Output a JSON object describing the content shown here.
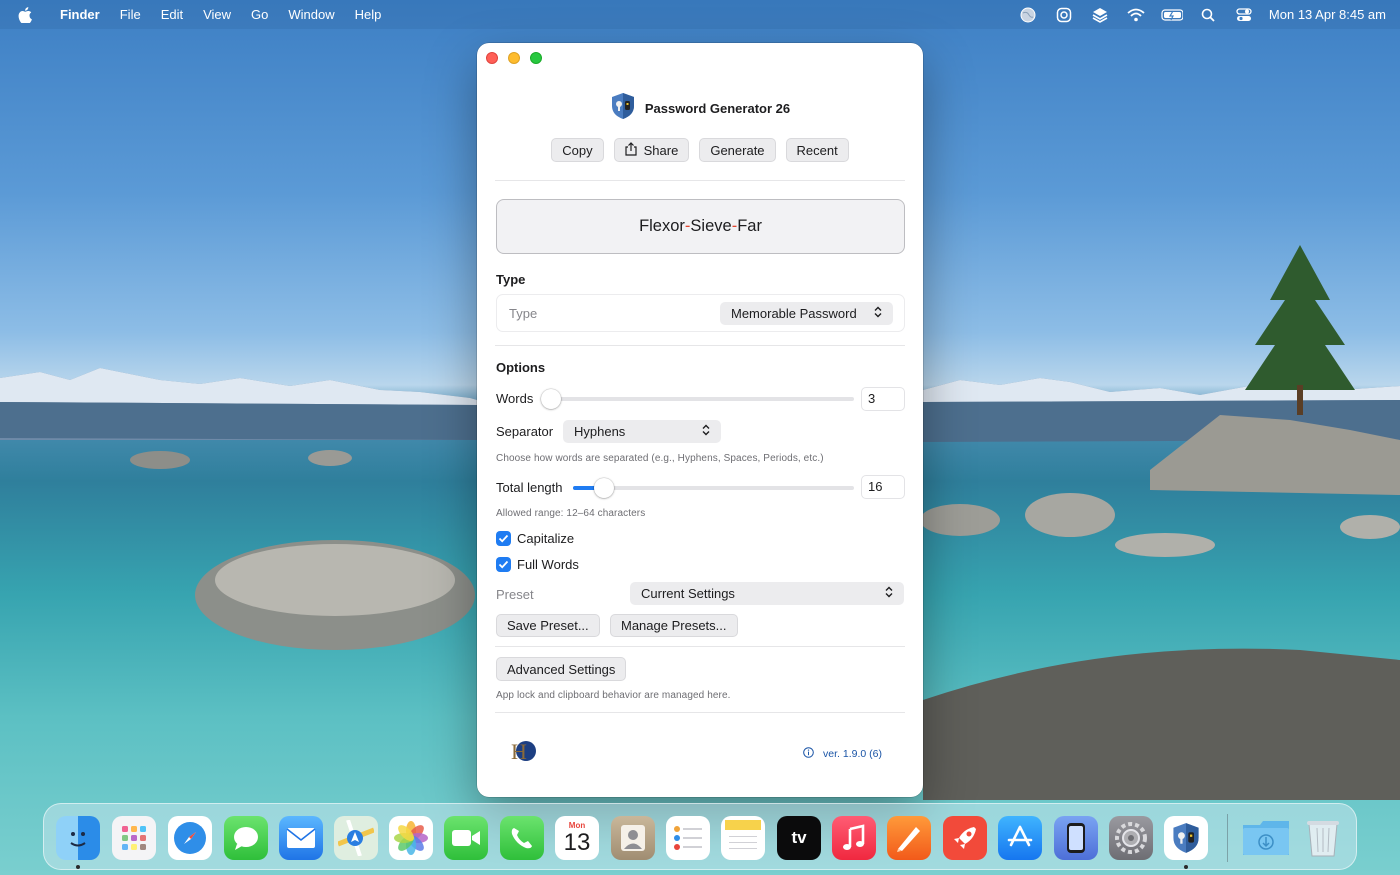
{
  "menubar": {
    "app_name": "Finder",
    "menus": [
      "File",
      "Edit",
      "View",
      "Go",
      "Window",
      "Help"
    ],
    "status_icons": [
      "globe-icon",
      "lifebuoy-icon",
      "layers-icon",
      "wifi-icon",
      "battery-icon",
      "search-icon",
      "control-center-icon"
    ],
    "clock": "Mon 13 Apr  8:45 am"
  },
  "window": {
    "app_title": "Password Generator 26",
    "toolbar": {
      "copy_label": "Copy",
      "share_label": "Share",
      "generate_label": "Generate",
      "recent_label": "Recent"
    },
    "password": {
      "words": [
        "Flexor",
        "Sieve",
        "Far"
      ],
      "separator": "-"
    },
    "type_section": {
      "title": "Type",
      "label": "Type",
      "selected": "Memorable Password"
    },
    "options": {
      "title": "Options",
      "words_label": "Words",
      "words_value": "3",
      "words_slider_fraction": 0.0,
      "separator_label": "Separator",
      "separator_selected": "Hyphens",
      "separator_help": "Choose how words are separated (e.g., Hyphens, Spaces, Periods, etc.)",
      "total_length_label": "Total length",
      "total_length_value": "16",
      "total_length_slider_fraction": 0.08,
      "length_help": "Allowed range: 12–64 characters",
      "capitalize_label": "Capitalize",
      "capitalize_checked": true,
      "full_words_label": "Full Words",
      "full_words_checked": true,
      "preset_label": "Preset",
      "preset_selected": "Current Settings",
      "save_preset_label": "Save Preset...",
      "manage_presets_label": "Manage Presets...",
      "advanced_label": "Advanced Settings",
      "advanced_help": "App lock and clipboard behavior are managed here."
    },
    "footer": {
      "logo_letter": "H",
      "version": "ver. 1.9.0 (6)"
    }
  },
  "dock": {
    "calendar": {
      "month": "Mon",
      "day": "13"
    },
    "tv_label": "tv",
    "apps": [
      "finder-icon",
      "launchpad-icon",
      "safari-icon",
      "messages-icon",
      "mail-icon",
      "maps-icon",
      "photos-icon",
      "facetime-icon",
      "phone-icon",
      "calendar-icon",
      "contacts-icon",
      "reminders-icon",
      "notes-icon",
      "apple-tv-icon",
      "music-icon",
      "pages-icon",
      "rocket-icon",
      "app-store-icon",
      "simulator-icon",
      "system-settings-icon",
      "password-generator-icon",
      "downloads-folder-icon",
      "trash-icon"
    ]
  }
}
